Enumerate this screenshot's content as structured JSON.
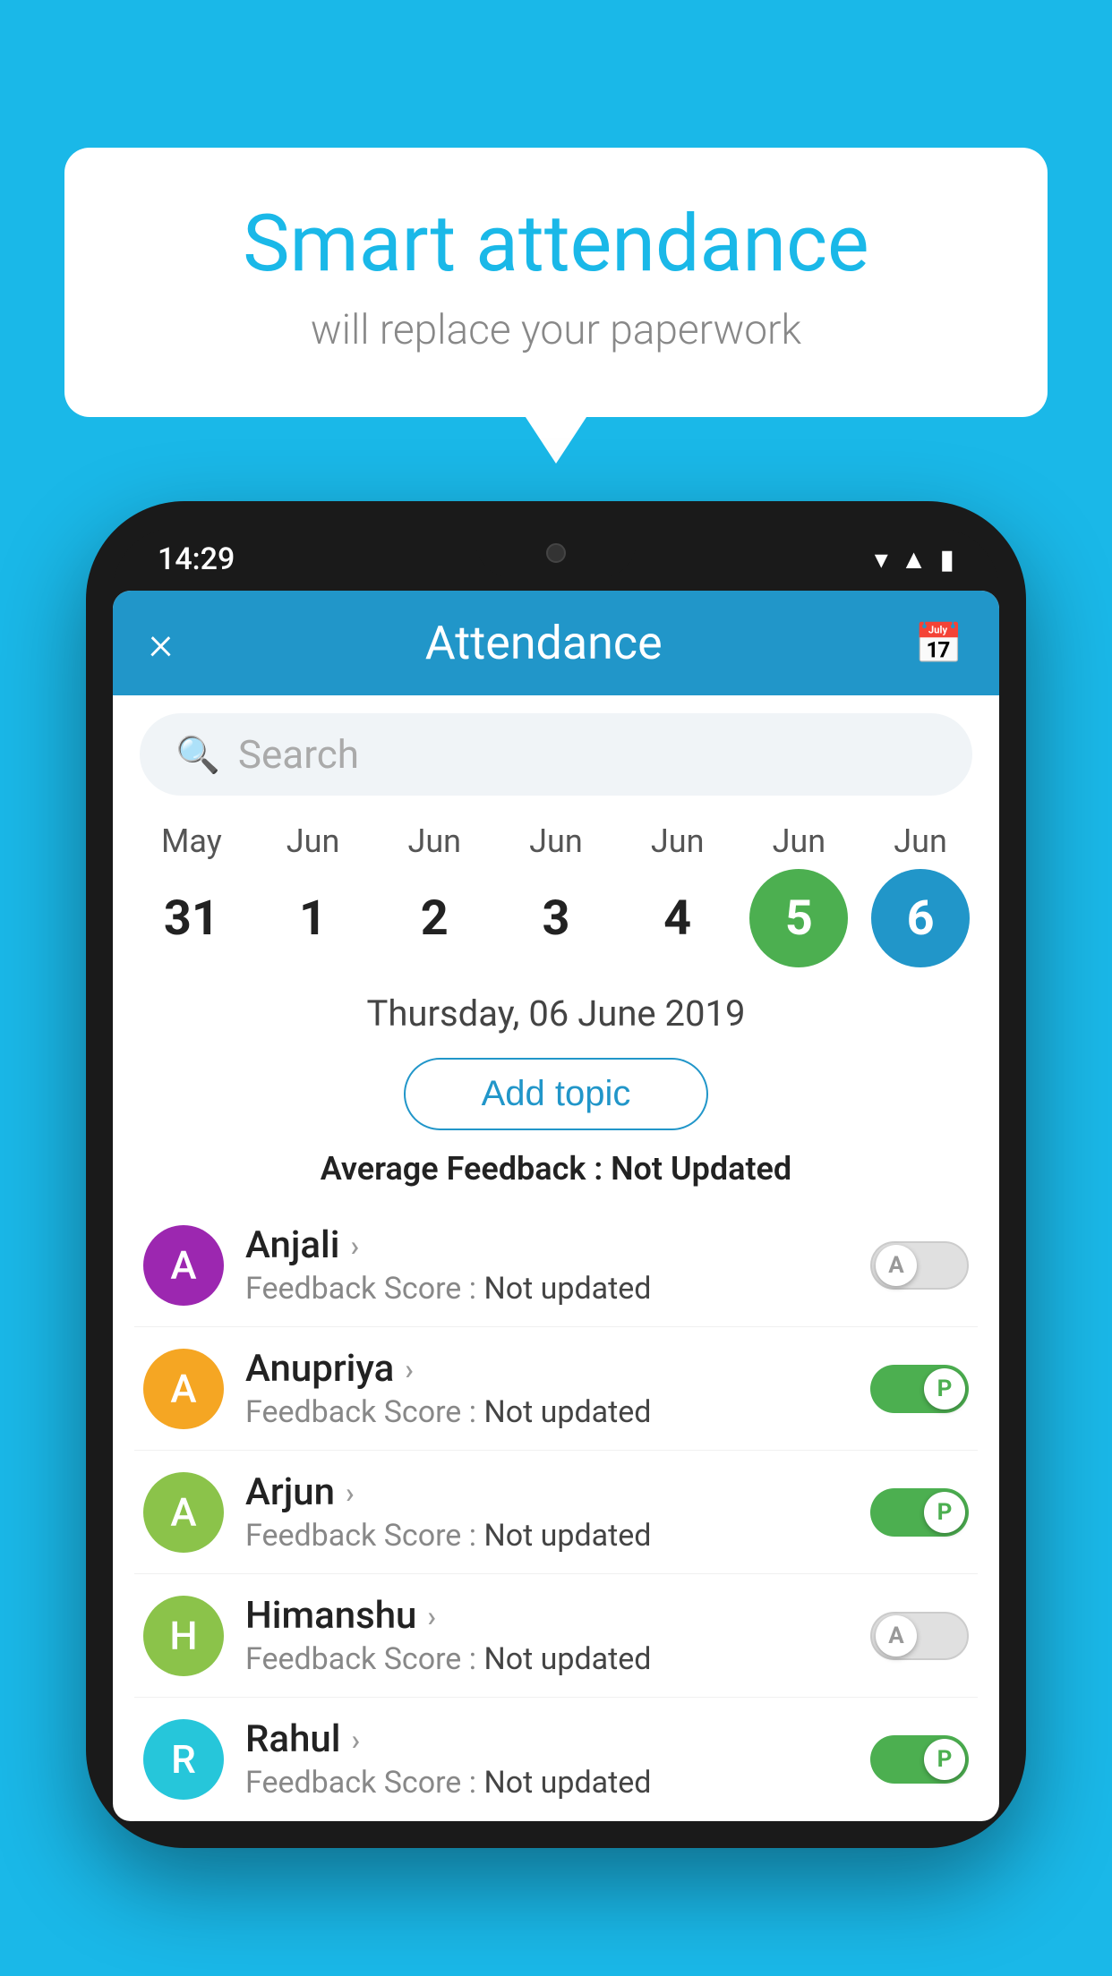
{
  "background_color": "#1ab8e8",
  "bubble": {
    "title": "Smart attendance",
    "subtitle": "will replace your paperwork"
  },
  "status_bar": {
    "time": "14:29",
    "icons": [
      "wifi",
      "signal",
      "battery"
    ]
  },
  "header": {
    "title": "Attendance",
    "close_label": "×",
    "calendar_icon": "📅"
  },
  "search": {
    "placeholder": "Search"
  },
  "calendar": {
    "days": [
      {
        "month": "May",
        "date": "31",
        "style": "normal"
      },
      {
        "month": "Jun",
        "date": "1",
        "style": "normal"
      },
      {
        "month": "Jun",
        "date": "2",
        "style": "normal"
      },
      {
        "month": "Jun",
        "date": "3",
        "style": "normal"
      },
      {
        "month": "Jun",
        "date": "4",
        "style": "normal"
      },
      {
        "month": "Jun",
        "date": "5",
        "style": "green"
      },
      {
        "month": "Jun",
        "date": "6",
        "style": "blue"
      }
    ],
    "selected_date": "Thursday, 06 June 2019"
  },
  "add_topic_label": "Add topic",
  "avg_feedback_label": "Average Feedback :",
  "avg_feedback_value": "Not Updated",
  "students": [
    {
      "name": "Anjali",
      "feedback_label": "Feedback Score :",
      "feedback_value": "Not updated",
      "avatar_letter": "A",
      "avatar_color": "#9c27b0",
      "toggle_state": "off",
      "toggle_label": "A"
    },
    {
      "name": "Anupriya",
      "feedback_label": "Feedback Score :",
      "feedback_value": "Not updated",
      "avatar_letter": "A",
      "avatar_color": "#f5a623",
      "toggle_state": "on",
      "toggle_label": "P"
    },
    {
      "name": "Arjun",
      "feedback_label": "Feedback Score :",
      "feedback_value": "Not updated",
      "avatar_letter": "A",
      "avatar_color": "#8bc34a",
      "toggle_state": "on",
      "toggle_label": "P"
    },
    {
      "name": "Himanshu",
      "feedback_label": "Feedback Score :",
      "feedback_value": "Not updated",
      "avatar_letter": "H",
      "avatar_color": "#8bc34a",
      "toggle_state": "off",
      "toggle_label": "A"
    },
    {
      "name": "Rahul",
      "feedback_label": "Feedback Score :",
      "feedback_value": "Not updated",
      "avatar_letter": "R",
      "avatar_color": "#26c6da",
      "toggle_state": "on",
      "toggle_label": "P"
    }
  ]
}
